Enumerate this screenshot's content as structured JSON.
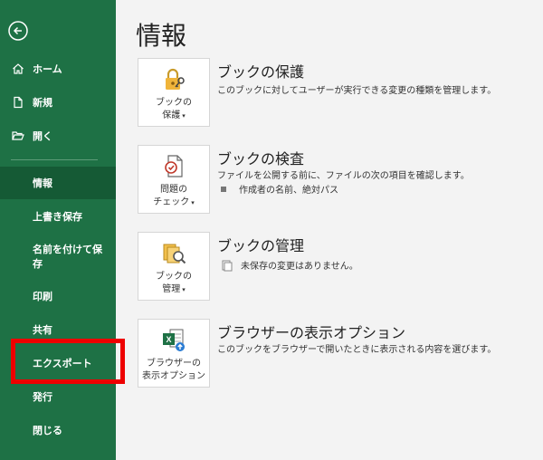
{
  "sidebar": {
    "home": "ホーム",
    "new": "新規",
    "open": "開く",
    "items": [
      "情報",
      "上書き保存",
      "名前を付けて保存",
      "印刷",
      "共有",
      "エクスポート",
      "発行",
      "閉じる"
    ]
  },
  "main": {
    "title": "情報",
    "sections": [
      {
        "title": "ブックの保護",
        "desc": "このブックに対してユーザーが実行できる変更の種類を管理します。",
        "button": [
          "ブックの",
          "保護"
        ]
      },
      {
        "title": "ブックの検査",
        "desc": "ファイルを公開する前に、ファイルの次の項目を確認します。",
        "bullet": "作成者の名前、絶対パス",
        "button": [
          "問題の",
          "チェック"
        ]
      },
      {
        "title": "ブックの管理",
        "bullet": "未保存の変更はありません。",
        "button": [
          "ブックの",
          "管理"
        ]
      },
      {
        "title": "ブラウザーの表示オプション",
        "desc": "このブックをブラウザーで開いたときに表示される内容を選びます。",
        "button": [
          "ブラウザーの",
          "表示オプション"
        ]
      }
    ]
  },
  "colors": {
    "sidebar": "#1e7145",
    "active": "#155a35",
    "highlight": "#ee0000"
  }
}
